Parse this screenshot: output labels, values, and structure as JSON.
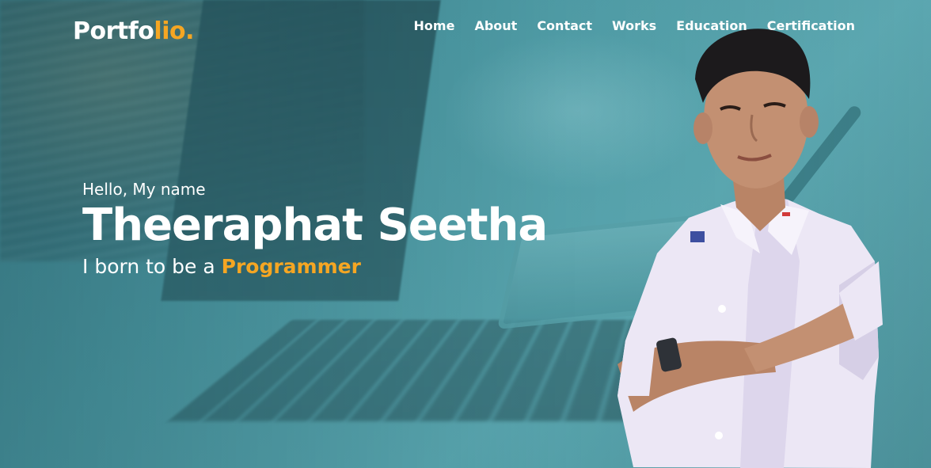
{
  "logo": {
    "main": "Portfo",
    "accent": "lio."
  },
  "nav": {
    "items": [
      {
        "label": "Home"
      },
      {
        "label": "About"
      },
      {
        "label": "Contact"
      },
      {
        "label": "Works"
      },
      {
        "label": "Education"
      },
      {
        "label": "Certification"
      }
    ]
  },
  "hero": {
    "greeting": "Hello, My name",
    "name": "Theeraphat Seetha",
    "tagline_prefix": "I born to be a ",
    "tagline_role": "Programmer"
  },
  "colors": {
    "accent": "#f5a623",
    "text": "#ffffff",
    "background": "#4f9aa4"
  }
}
